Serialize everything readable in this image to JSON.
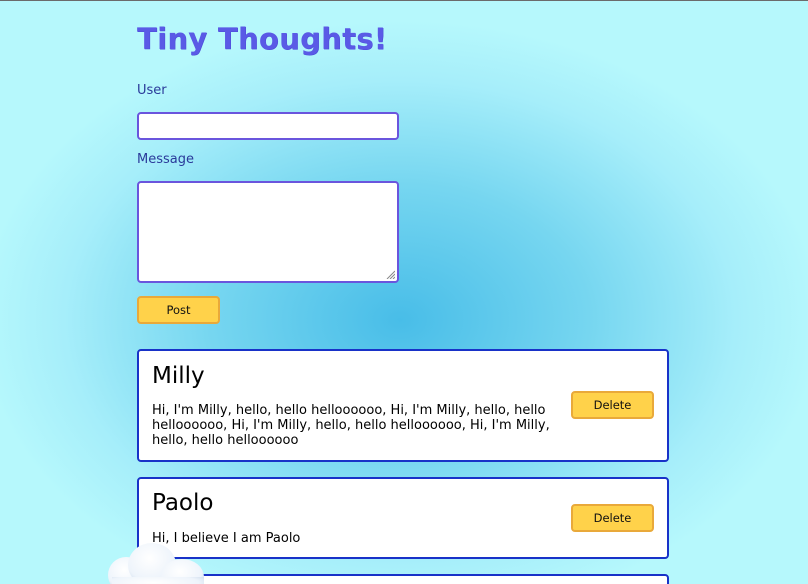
{
  "app": {
    "title": "Tiny Thoughts!"
  },
  "form": {
    "user_label": "User",
    "user_value": "",
    "message_label": "Message",
    "message_value": "",
    "post_label": "Post"
  },
  "posts": [
    {
      "user": "Milly",
      "message": "Hi, I'm Milly, hello, hello helloooooo, Hi, I'm Milly, hello, hello helloooooo, Hi, I'm Milly, hello, hello helloooooo, Hi, I'm Milly, hello, hello helloooooo",
      "delete_label": "Delete"
    },
    {
      "user": "Paolo",
      "message": "Hi, I believe I am Paolo",
      "delete_label": "Delete"
    }
  ],
  "colors": {
    "title": "#5a5ae6",
    "card_border": "#1832c8",
    "button_fill": "#ffd24a",
    "button_border": "#e9a93a",
    "label": "#2a3a9a"
  },
  "icons": {
    "resize_handle": "resize-grip-icon",
    "cloud": "cloud-decoration"
  }
}
